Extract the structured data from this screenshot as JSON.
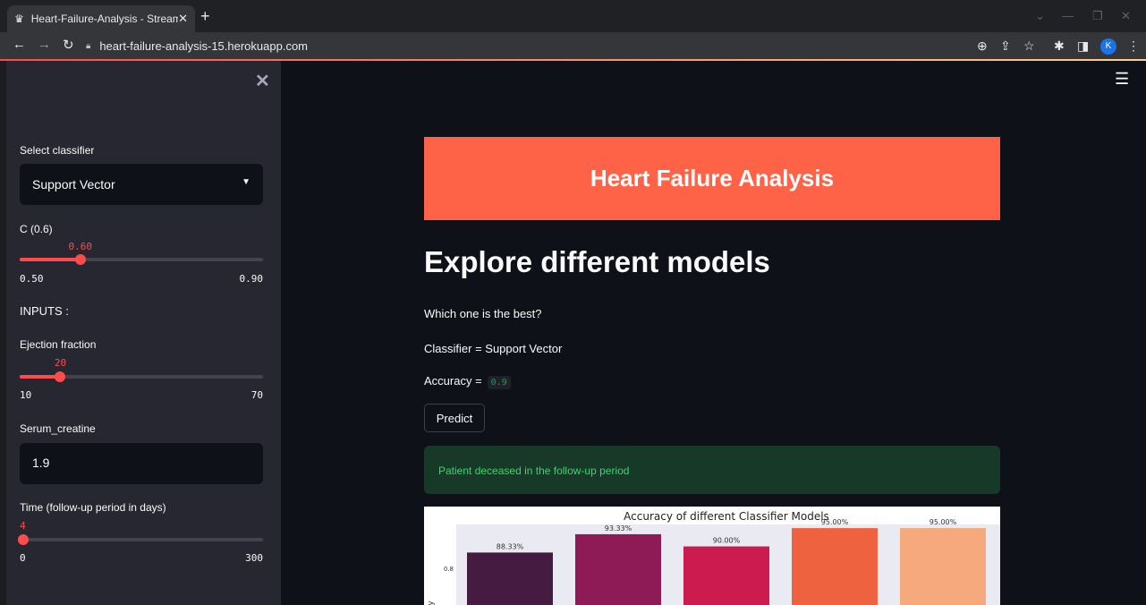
{
  "browser": {
    "tab_title": "Heart-Failure-Analysis - Streamlit",
    "url": "heart-failure-analysis-15.herokuapp.com",
    "profile_initial": "K"
  },
  "sidebar": {
    "classifier_label": "Select classifier",
    "classifier_value": "Support Vector",
    "c_label": "C (0.6)",
    "c_slider": {
      "value_label": "0.60",
      "min_label": "0.50",
      "max_label": "0.90",
      "min": 0.5,
      "max": 0.9,
      "value": 0.6
    },
    "inputs_heading": "INPUTS :",
    "ejection_label": "Ejection fraction",
    "ejection_slider": {
      "value_label": "20",
      "min_label": "10",
      "max_label": "70",
      "min": 10,
      "max": 70,
      "value": 20
    },
    "serum_label": "Serum_creatine",
    "serum_value": "1.9",
    "time_label": "Time (follow-up period in days)",
    "time_slider": {
      "value_label": "4",
      "min_label": "0",
      "max_label": "300",
      "min": 0,
      "max": 300,
      "value": 4
    }
  },
  "main": {
    "banner_title": "Heart Failure Analysis",
    "heading": "Explore different models",
    "question": "Which one is the best?",
    "classifier_text": "Classifier = Support Vector",
    "accuracy_label": "Accuracy =",
    "accuracy_value": "0.9",
    "predict_label": "Predict",
    "result_text": "Patient deceased in the follow-up period"
  },
  "colors": {
    "accent": "#ff4b4b",
    "banner": "#ff6347",
    "success_bg": "#173928",
    "success_text": "#3dd56d"
  },
  "chart_data": {
    "type": "bar",
    "title": "Accuracy of different Classifier Models",
    "values": [
      0.8833,
      0.9333,
      0.9,
      0.95,
      0.95
    ],
    "labels": [
      "88.33%",
      "93.33%",
      "90.00%",
      "95.00%",
      "95.00%"
    ],
    "colors": [
      "#451b42",
      "#8e1a56",
      "#cb1b4f",
      "#ef6240",
      "#f5a97c"
    ],
    "ytick_labels": [
      "0.8"
    ],
    "ylabel": "y",
    "ylim_visible": [
      0.74,
      0.96
    ]
  }
}
